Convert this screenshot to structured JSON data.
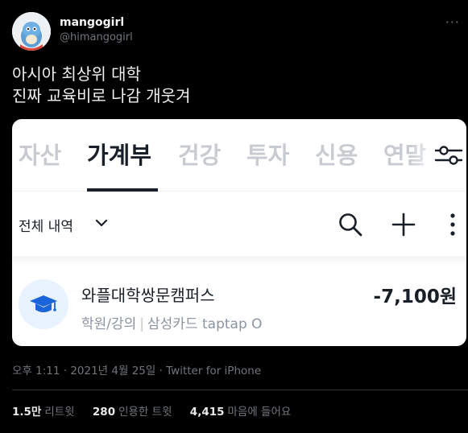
{
  "tweet": {
    "display_name": "mangogirl",
    "handle": "@himangogirl",
    "text_line1": "아시아 최상위 대학",
    "text_line2": "진짜 교육비로 나감 개웃겨",
    "timestamp": "오후 1:11 · 2021년 4월 25일 · Twitter for iPhone"
  },
  "stats": {
    "retweets_count": "1.5만",
    "retweets_label": "리트윗",
    "quotes_count": "280",
    "quotes_label": "인용한 트윗",
    "likes_count": "4,415",
    "likes_label": "마음에 들어요"
  },
  "app": {
    "tabs": [
      "자산",
      "가계부",
      "건강",
      "투자",
      "신용",
      "연말"
    ],
    "active_tab": "가계부",
    "filter_label": "전체 내역",
    "transaction": {
      "merchant": "와플대학쌍문캠퍼스",
      "category": "학원/강의",
      "card": "삼성카드 taptap O",
      "amount": "-7,100원",
      "icon": "graduation-cap-icon"
    }
  },
  "colors": {
    "background": "#000000",
    "muted": "#71767b",
    "card_bg": "#ffffff",
    "active_tab": "#191f28",
    "inactive_tab": "#c8ccd2",
    "icon_circle": "#e8f3ff",
    "cap": "#1b64da"
  }
}
